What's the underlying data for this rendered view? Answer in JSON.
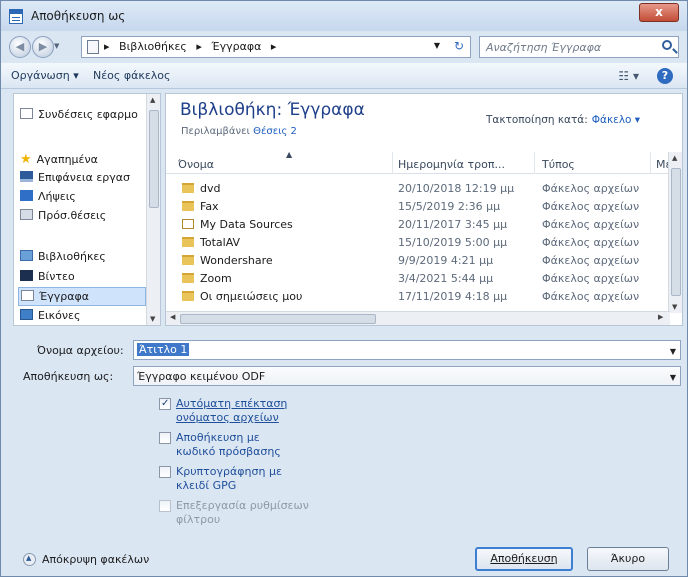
{
  "window": {
    "title": "Αποθήκευση ως",
    "close_label": "x"
  },
  "address": {
    "crumbs": [
      "Βιβλιοθήκες",
      "Έγγραφα"
    ]
  },
  "search": {
    "placeholder": "Αναζήτηση Έγγραφα"
  },
  "toolbar": {
    "organize": "Οργάνωση ▾",
    "new_folder": "Νέος φάκελος"
  },
  "nav": {
    "items": [
      "Συνδέσεις εφαρμο",
      "Αγαπημένα",
      "Επιφάνεια εργασ",
      "Λήψεις",
      "Πρόσ.θέσεις",
      "Βιβλιοθήκες",
      "Βίντεο",
      "Έγγραφα",
      "Εικόνες"
    ]
  },
  "library": {
    "title": "Βιβλιοθήκη: Έγγραφα",
    "includes_label": "Περιλαμβάνει",
    "includes_link": "Θέσεις 2",
    "arrange_label": "Τακτοποίηση κατά:",
    "arrange_value": "Φάκελο ▾"
  },
  "columns": {
    "name": "Όνομα",
    "date": "Ημερομηνία τροπ...",
    "type": "Τύπος",
    "size": "Με"
  },
  "files": [
    {
      "name": "dvd",
      "date": "20/10/2018 12:19 μμ",
      "type": "Φάκελος αρχείων"
    },
    {
      "name": "Fax",
      "date": "15/5/2019 2:36 μμ",
      "type": "Φάκελος αρχείων"
    },
    {
      "name": "My Data Sources",
      "date": "20/11/2017 3:45 μμ",
      "type": "Φάκελος αρχείων"
    },
    {
      "name": "TotalAV",
      "date": "15/10/2019 5:00 μμ",
      "type": "Φάκελος αρχείων"
    },
    {
      "name": "Wondershare",
      "date": "9/9/2019 4:21 μμ",
      "type": "Φάκελος αρχείων"
    },
    {
      "name": "Zoom",
      "date": "3/4/2021 5:44 μμ",
      "type": "Φάκελος αρχείων"
    },
    {
      "name": "Οι σημειώσεις μου",
      "date": "17/11/2019 4:18 μμ",
      "type": "Φάκελος αρχείων"
    }
  ],
  "form": {
    "filename_label": "Όνομα αρχείου:",
    "filename_value": "Άτιτλο 1",
    "savetype_label": "Αποθήκευση ως:",
    "savetype_value": "Έγγραφο κειμένου ODF"
  },
  "options": [
    {
      "label": "Αυτόματη επέκταση ονόματος αρχείων",
      "checked": true,
      "enabled": true
    },
    {
      "label": "Αποθήκευση με κωδικό πρόσβασης",
      "checked": false,
      "enabled": true
    },
    {
      "label": "Κρυπτογράφηση με κλειδί GPG",
      "checked": false,
      "enabled": true
    },
    {
      "label": "Επεξεργασία ρυθμίσεων φίλτρου",
      "checked": false,
      "enabled": false
    }
  ],
  "footer": {
    "hide_folders": "Απόκρυψη φακέλων",
    "save": "Αποθήκευση",
    "cancel": "Άκυρο"
  }
}
